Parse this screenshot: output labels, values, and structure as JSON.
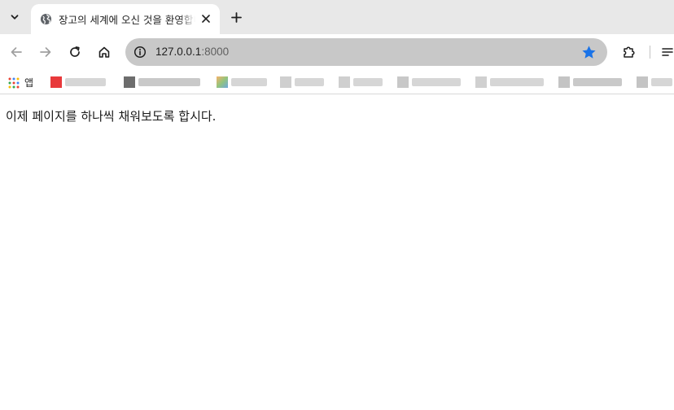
{
  "tab": {
    "title": "장고의 세계에 오신 것을 환영합니다"
  },
  "omnibox": {
    "host": "127.0.0.1",
    "port": ":8000"
  },
  "bookmarks": {
    "apps_label": "앱",
    "colors": {
      "red_favicon": "#e8393b",
      "star": "#1a73e8"
    }
  },
  "page": {
    "body_text": "이제 페이지를 하나씩 채워보도록 합시다."
  }
}
